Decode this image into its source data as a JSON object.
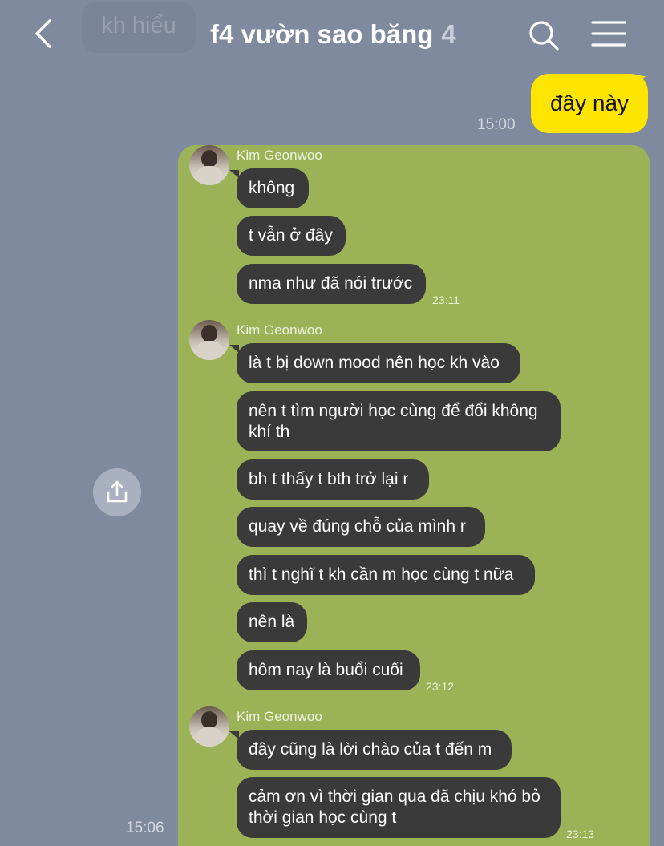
{
  "header": {
    "back_label": "back",
    "ghost_text": "kh hiểu",
    "title": "f4 vườn sao băng",
    "member_count": "4"
  },
  "outgoing": {
    "text": "đây này",
    "time": "15:00"
  },
  "share": {
    "icon": "share-icon"
  },
  "forwarded_time": "15:06",
  "groups": [
    {
      "sender": "Kim Geonwoo",
      "messages": [
        "không",
        "t vẫn ở đây",
        "nma như đã nói trước"
      ],
      "time": "23:11"
    },
    {
      "sender": "Kim Geonwoo",
      "messages": [
        "là t bị down mood nên học kh vào",
        "nên t tìm người học cùng để đổi không\nkhí th",
        "bh t thấy t bth trở lại r",
        "quay về đúng chỗ của mình r",
        "thì t nghĩ t kh cần m học cùng t nữa",
        "nên là",
        "hôm nay là buổi cuối"
      ],
      "time": "23:12"
    },
    {
      "sender": "Kim Geonwoo",
      "messages": [
        "đây cũng là lời chào của t đến m",
        "cảm ơn vì thời gian qua đã chịu khó bỏ\nthời gian học cùng t"
      ],
      "time": "23:13"
    }
  ],
  "colors": {
    "background": "#7f8a9e",
    "my_bubble": "#fee500",
    "panel": "#9bb356",
    "their_bubble": "#3a3a3a"
  }
}
